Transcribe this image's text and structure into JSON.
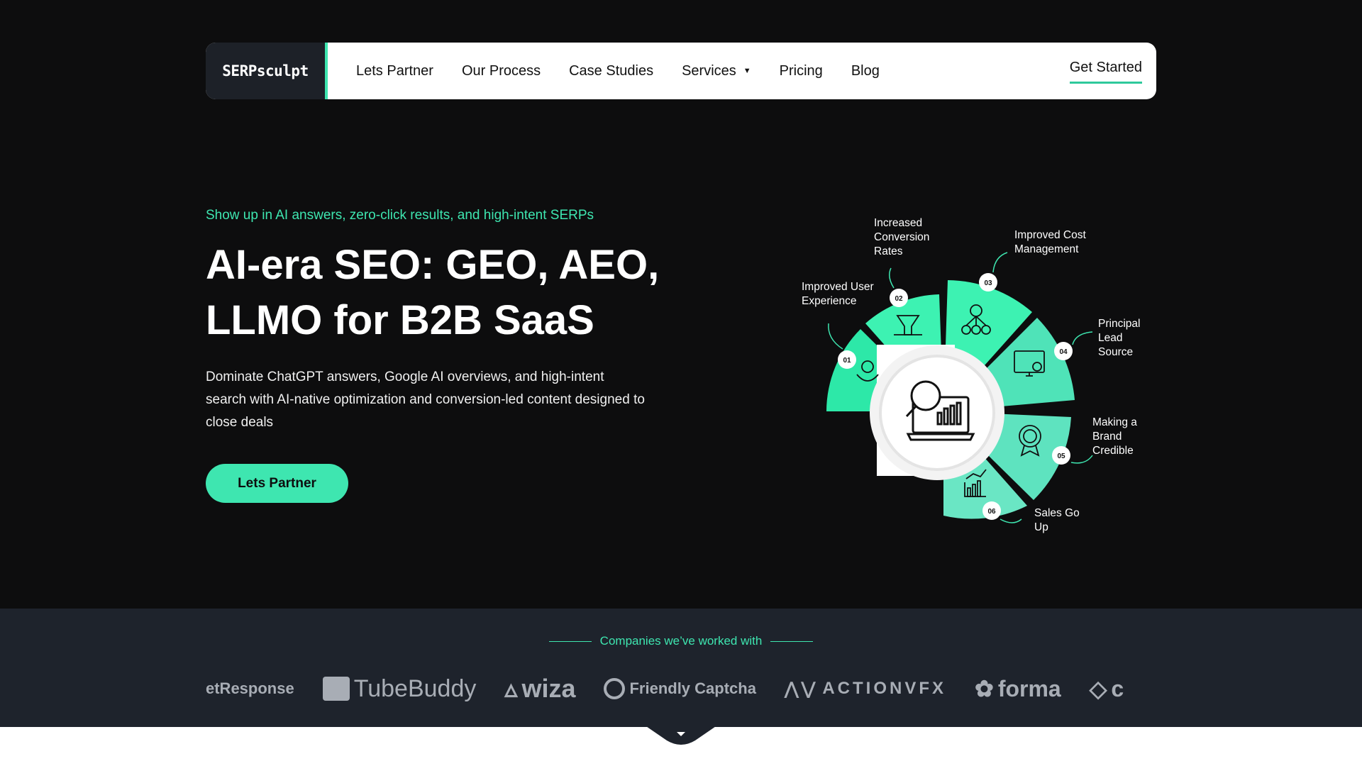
{
  "nav": {
    "logo": "SERPsculpt",
    "links": [
      "Lets Partner",
      "Our Process",
      "Case Studies",
      "Services",
      "Pricing",
      "Blog"
    ],
    "get_started": "Get Started"
  },
  "hero": {
    "eyebrow": "Show up in AI answers, zero-click results, and high-intent SERPs",
    "headline": "AI-era SEO: GEO, AEO, LLMO for B2B SaaS",
    "subtext": "Dominate ChatGPT answers, Google AI overviews, and high-intent search with AI-native optimization and conversion-led content designed to close deals",
    "cta": "Lets Partner"
  },
  "diagram": {
    "steps": [
      {
        "num": "01",
        "label": "Improved User Experience",
        "icon": "hands-heart-icon"
      },
      {
        "num": "02",
        "label": "Increased Conversion Rates",
        "icon": "funnel-icon"
      },
      {
        "num": "03",
        "label": "Improved Cost Management",
        "icon": "money-network-icon"
      },
      {
        "num": "04",
        "label": "Principal Lead Source",
        "icon": "monitor-megaphone-icon"
      },
      {
        "num": "05",
        "label": "Making a Brand Credible",
        "icon": "award-badge-icon"
      },
      {
        "num": "06",
        "label": "Sales Go Up",
        "icon": "growth-chart-icon"
      }
    ],
    "center_icon": "laptop-search-analytics-icon"
  },
  "clients": {
    "title": "Companies we’ve worked with",
    "logos": [
      "etResponse",
      "TubeBuddy",
      "wiza",
      "Friendly Captcha",
      "ACTIONVFX",
      "forma",
      "c"
    ]
  },
  "colors": {
    "accent": "#3ee6b0",
    "background": "#0d0d0e",
    "strip": "#1e232c"
  }
}
